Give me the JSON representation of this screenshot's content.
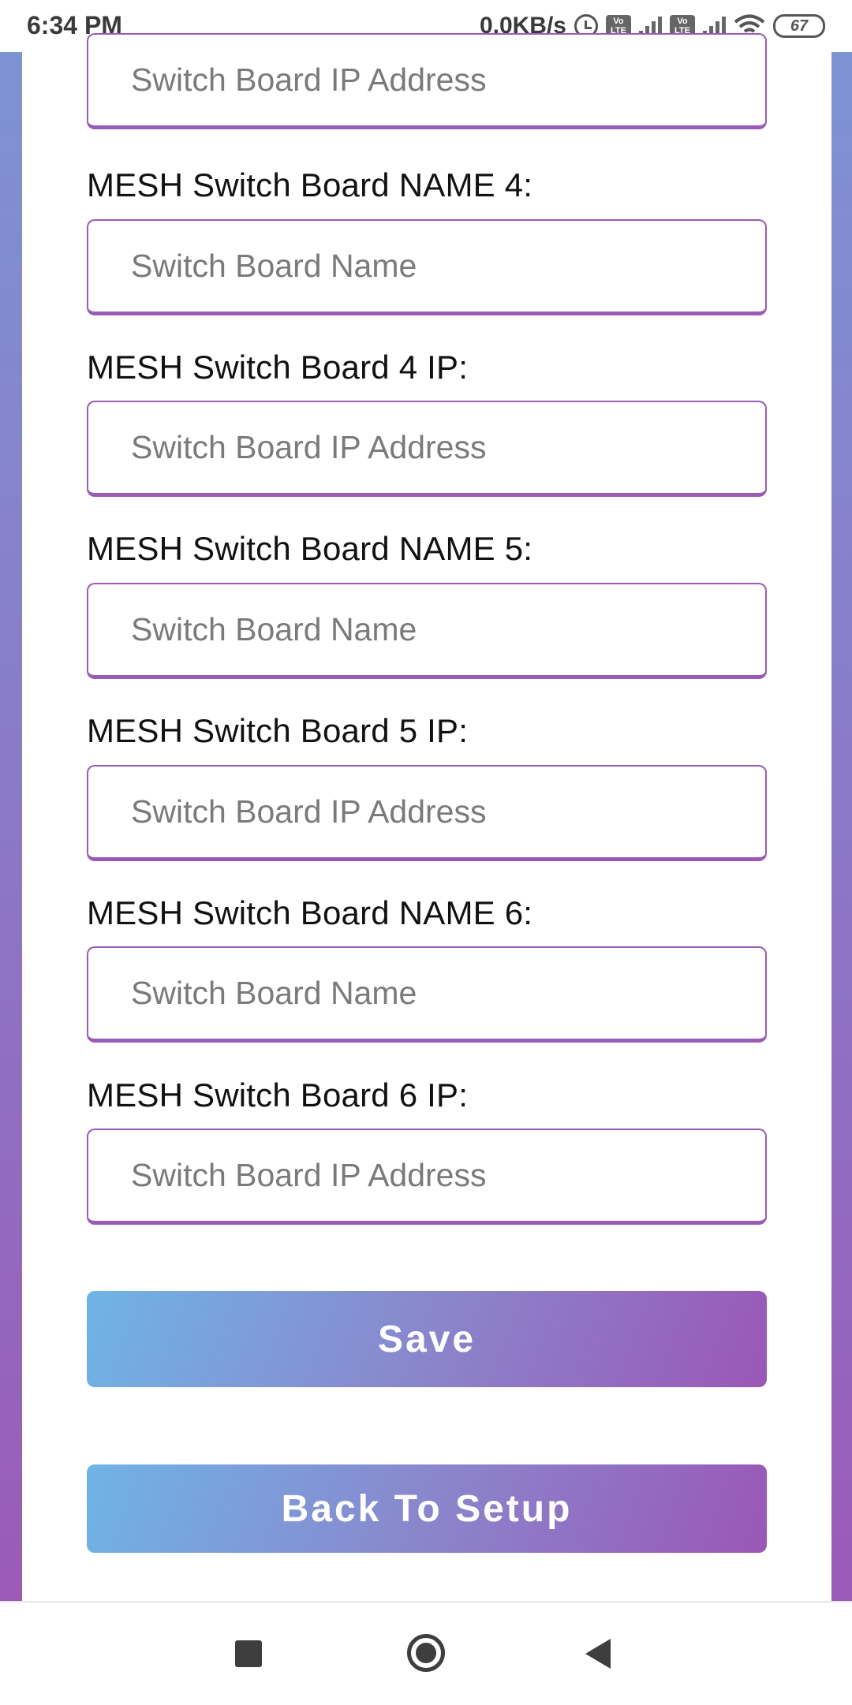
{
  "status_bar": {
    "time": "6:34 PM",
    "net_speed": "0.0KB/s",
    "volte_1": "Vo LTE",
    "volte_2": "Vo LTE",
    "battery": "67"
  },
  "form": {
    "fields": [
      {
        "label": "",
        "placeholder": "Switch Board IP Address",
        "value": ""
      },
      {
        "label": "MESH Switch Board NAME 4:",
        "placeholder": "Switch Board Name",
        "value": ""
      },
      {
        "label": "MESH Switch Board 4 IP:",
        "placeholder": "Switch Board IP Address",
        "value": ""
      },
      {
        "label": "MESH Switch Board NAME 5:",
        "placeholder": "Switch Board Name",
        "value": ""
      },
      {
        "label": "MESH Switch Board 5 IP:",
        "placeholder": "Switch Board IP Address",
        "value": ""
      },
      {
        "label": "MESH Switch Board NAME 6:",
        "placeholder": "Switch Board Name",
        "value": ""
      },
      {
        "label": "MESH Switch Board 6 IP:",
        "placeholder": "Switch Board IP Address",
        "value": ""
      }
    ],
    "save_label": "Save",
    "back_label": "Back To Setup"
  },
  "colors": {
    "accent": "#9a5bb7",
    "gradient_start": "#6fb4e6",
    "gradient_end": "#9a57b6"
  },
  "nav_bar": {
    "icons": [
      "recents-icon",
      "home-icon",
      "back-icon"
    ]
  }
}
